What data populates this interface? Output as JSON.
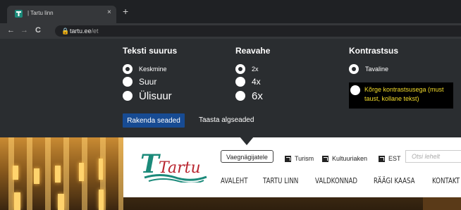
{
  "browser": {
    "tab_title": "| Tartu linn",
    "tab_close": "×",
    "new_tab": "+",
    "back": "←",
    "forward": "→",
    "reload": "C",
    "url_host": "tartu.ee",
    "url_path": "/et"
  },
  "accessibility": {
    "text_size": {
      "title": "Teksti suurus",
      "options": [
        "Keskmine",
        "Suur",
        "Ülisuur"
      ],
      "selected": "Keskmine"
    },
    "line_spacing": {
      "title": "Reavahe",
      "options": [
        "2x",
        "4x",
        "6x"
      ],
      "selected": "2x"
    },
    "contrast": {
      "title": "Kontrastsus",
      "options": [
        "Tavaline",
        "Kõrge kontrastsusega (must taust, kollane tekst)"
      ],
      "selected": "Tavaline"
    },
    "apply_label": "Rakenda seaded",
    "reset_label": "Taasta algseaded"
  },
  "site": {
    "logo_text": "Tartu",
    "accessibility_button": "Vaegnägijatele",
    "links": [
      "Turism",
      "Kultuuriaken",
      "EST"
    ],
    "search_placeholder": "Otsi lehelt",
    "main_nav": [
      "AVALEHT",
      "TARTU LINN",
      "VALDKONNAD",
      "RÄÄGI KAASA",
      "KONTAKT"
    ]
  },
  "colors": {
    "panel_bg": "#2a2d30",
    "apply_bg": "#174b93",
    "high_contrast_text": "#f5dd2b",
    "logo_green": "#1b8a7a",
    "logo_red": "#b8252f"
  }
}
